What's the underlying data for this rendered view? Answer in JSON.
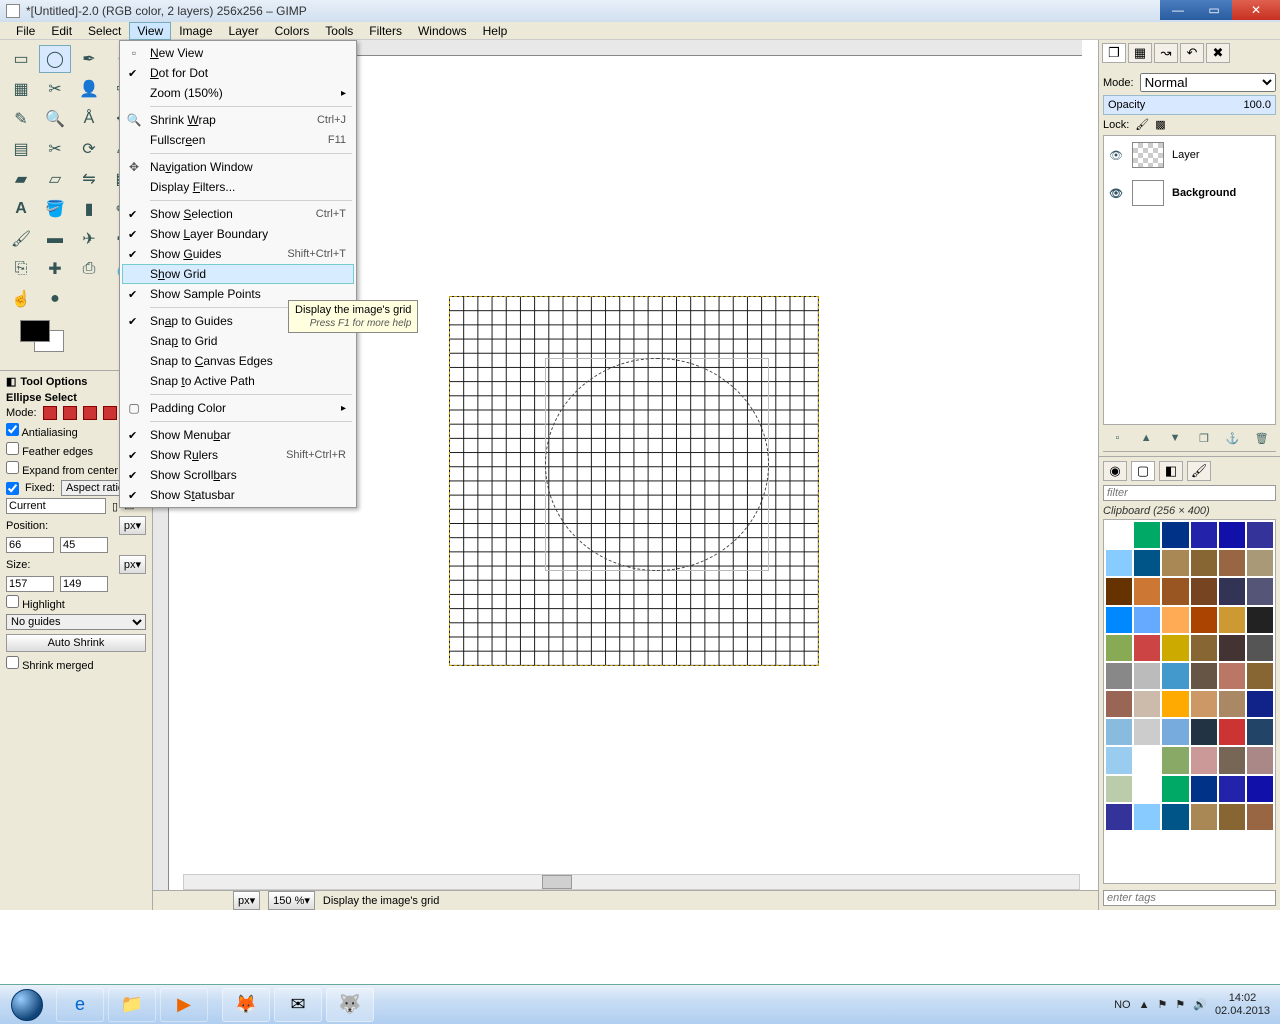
{
  "title": "*[Untitled]-2.0 (RGB color, 2 layers) 256x256 – GIMP",
  "menubar": [
    "File",
    "Edit",
    "Select",
    "View",
    "Image",
    "Layer",
    "Colors",
    "Tools",
    "Filters",
    "Windows",
    "Help"
  ],
  "view_menu": {
    "new_view": "New View",
    "dot_for_dot": "Dot for Dot",
    "zoom": "Zoom (150%)",
    "shrink_wrap": "Shrink Wrap",
    "shrink_wrap_k": "Ctrl+J",
    "fullscreen": "Fullscreen",
    "fullscreen_k": "F11",
    "nav_window": "Navigation Window",
    "display_filters": "Display Filters...",
    "show_selection": "Show Selection",
    "show_selection_k": "Ctrl+T",
    "show_layer_boundary": "Show Layer Boundary",
    "show_guides": "Show Guides",
    "show_guides_k": "Shift+Ctrl+T",
    "show_grid": "Show Grid",
    "show_sample_points": "Show Sample Points",
    "snap_guides": "Snap to Guides",
    "snap_grid": "Snap to Grid",
    "snap_canvas": "Snap to Canvas Edges",
    "snap_path": "Snap to Active Path",
    "padding_color": "Padding Color",
    "show_menubar": "Show Menubar",
    "show_rulers": "Show Rulers",
    "show_rulers_k": "Shift+Ctrl+R",
    "show_scrollbars": "Show Scrollbars",
    "show_statusbar": "Show Statusbar"
  },
  "tooltip": {
    "title": "Display the image's grid",
    "sub": "Press F1 for more help"
  },
  "tool_options": {
    "header": "Tool Options",
    "tool": "Ellipse Select",
    "mode": "Mode:",
    "antialiasing": "Antialiasing",
    "feather": "Feather edges",
    "expand": "Expand from center",
    "fixed": "Fixed:",
    "fixed_val": "Aspect ratio",
    "current": "Current",
    "position": "Position:",
    "unit": "px",
    "pos_x": "66",
    "pos_y": "45",
    "size": "Size:",
    "size_w": "157",
    "size_h": "149",
    "highlight": "Highlight",
    "guides": "No guides",
    "auto_shrink": "Auto Shrink",
    "shrink_merged": "Shrink merged"
  },
  "status": {
    "unit": "px",
    "zoom": "150 %",
    "text": "Display the image's grid"
  },
  "layers": {
    "mode_label": "Mode:",
    "mode": "Normal",
    "opacity_label": "Opacity",
    "opacity": "100.0",
    "lock_label": "Lock:",
    "items": [
      {
        "name": "Layer",
        "bold": false,
        "checker": true
      },
      {
        "name": "Background",
        "bold": true,
        "checker": false
      }
    ]
  },
  "patterns": {
    "filter_placeholder": "filter",
    "title": "Clipboard (256 × 400)",
    "entertags": "enter tags"
  },
  "taskbar": {
    "lang": "NO",
    "time": "14:02",
    "date": "02.04.2013"
  }
}
